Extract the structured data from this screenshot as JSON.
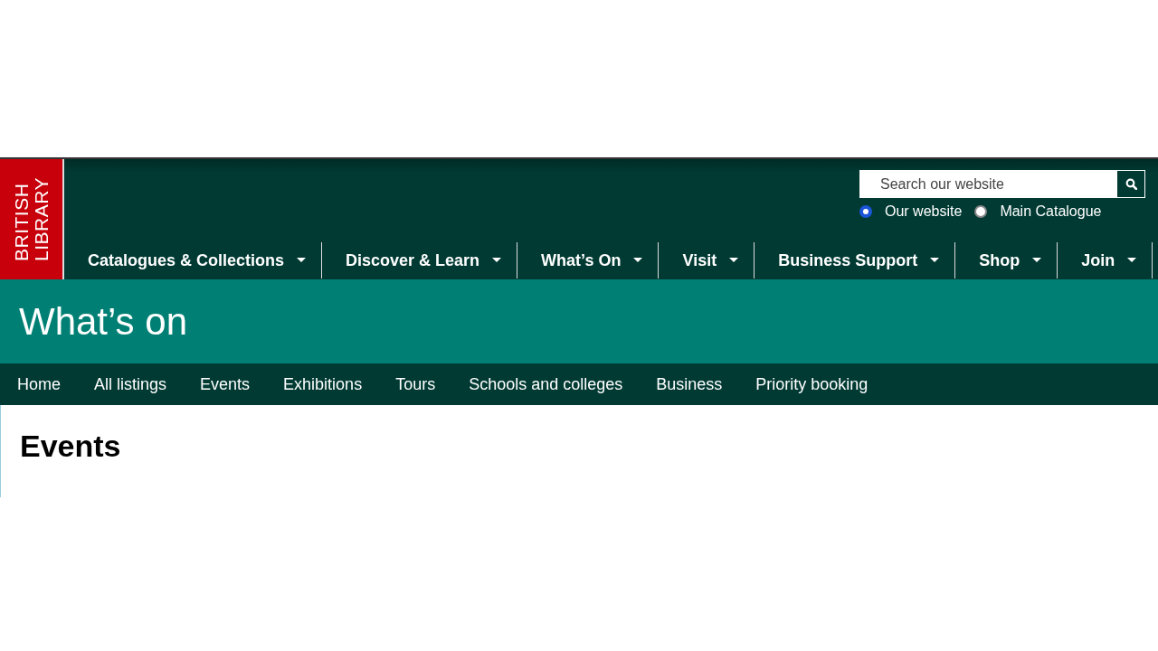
{
  "logo": {
    "lines": [
      "BRITISH",
      "LIBRARY"
    ]
  },
  "search": {
    "placeholder": "Search our website",
    "scopes": [
      {
        "label": "Our website",
        "selected": true
      },
      {
        "label": "Main Catalogue",
        "selected": false
      }
    ]
  },
  "main_nav": [
    {
      "label": "Catalogues & Collections"
    },
    {
      "label": "Discover & Learn"
    },
    {
      "label": "What’s On"
    },
    {
      "label": "Visit"
    },
    {
      "label": "Business Support"
    },
    {
      "label": "Shop"
    },
    {
      "label": "Join"
    }
  ],
  "section": {
    "title": "What’s on"
  },
  "sub_nav": [
    "Home",
    "All listings",
    "Events",
    "Exhibitions",
    "Tours",
    "Schools and colleges",
    "Business",
    "Priority booking"
  ],
  "page": {
    "heading": "Events"
  }
}
